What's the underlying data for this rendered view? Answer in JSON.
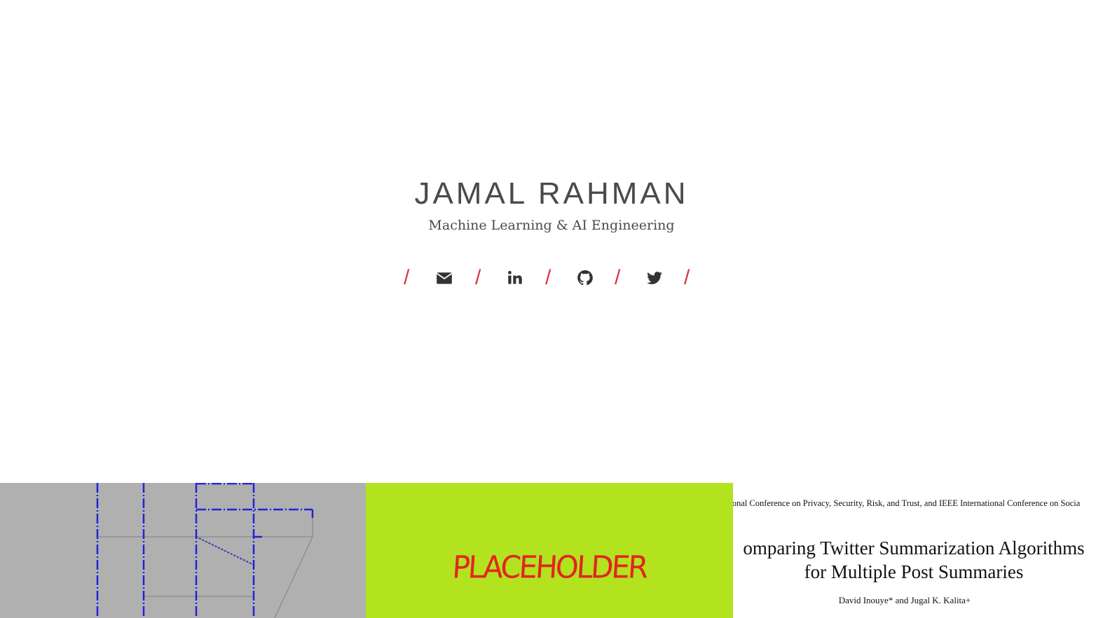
{
  "header": {
    "name": "JAMAL RAHMAN",
    "tagline": "Machine Learning & AI Engineering"
  },
  "social": {
    "separator": "/",
    "links": [
      {
        "icon": "envelope-icon",
        "label": "Email"
      },
      {
        "icon": "linkedin-icon",
        "label": "LinkedIn"
      },
      {
        "icon": "github-icon",
        "label": "GitHub"
      },
      {
        "icon": "twitter-icon",
        "label": "Twitter"
      }
    ],
    "separator_color": "#d9363e",
    "icon_color": "#333333"
  },
  "gallery": {
    "tiles": [
      {
        "kind": "floorplan-diagram",
        "background": "#b0b0b0"
      },
      {
        "kind": "placeholder",
        "text": "PLACEHOLDER",
        "background": "#b3e21f",
        "text_color": "#e3251e"
      },
      {
        "kind": "paper",
        "conference": "national Conference on Privacy, Security, Risk, and Trust, and IEEE International Conference on Socia",
        "title_line1": "omparing Twitter Summarization Algorithms",
        "title_line2": "for Multiple Post Summaries",
        "authors": "David Inouye* and Jugal K. Kalita+"
      }
    ]
  }
}
